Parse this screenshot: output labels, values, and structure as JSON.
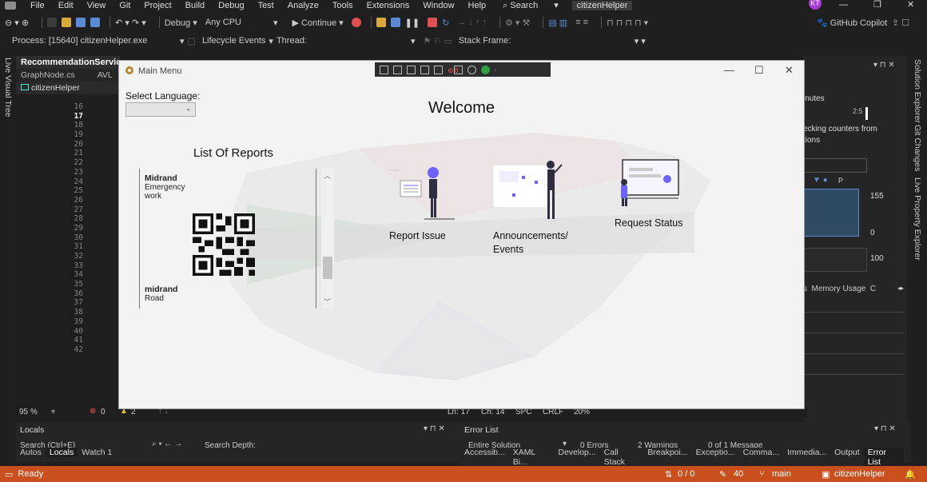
{
  "ide": {
    "menu": [
      "File",
      "Edit",
      "View",
      "Git",
      "Project",
      "Build",
      "Debug",
      "Test",
      "Analyze",
      "Tools",
      "Extensions",
      "Window",
      "Help"
    ],
    "search": "Search",
    "project_title": "citizenHelper",
    "avatar": "KT",
    "copilot": "GitHub Copilot",
    "toolbar": {
      "config": "Debug",
      "platform": "Any CPU",
      "continue": "Continue"
    },
    "toolbar2": {
      "process": "Process: [15640] citizenHelper.exe",
      "lifecycle": "Lifecycle Events",
      "thread": "Thread:",
      "stack": "Stack Frame:"
    },
    "left_tab": "Live Visual Tree",
    "editor_tabs": {
      "active": "RecommendationService",
      "second": "GraphNode.cs",
      "second_suffix": "AVL",
      "project": "citizenHelper"
    },
    "line_numbers": [
      "16",
      "17",
      "18",
      "19",
      "20",
      "21",
      "22",
      "23",
      "24",
      "25",
      "26",
      "27",
      "28",
      "29",
      "30",
      "31",
      "32",
      "33",
      "34",
      "35",
      "36",
      "37",
      "38",
      "39",
      "40",
      "41",
      "42"
    ],
    "right_panel": {
      "minutes": "inutes",
      "time": "2:5",
      "counters": "ecking counters from",
      "options": "tions",
      "legend": "P",
      "v155": "155",
      "v0": "0",
      "v100": "100",
      "tabs": "s  Memory Usage  C"
    },
    "right_tabs": [
      "Solution Explorer",
      "Git Changes",
      "Live Property Explorer"
    ],
    "status_line": {
      "zoom": "95 %",
      "errors": "0",
      "warnings": "2",
      "ln": "Ln: 17",
      "ch": "Ch: 14",
      "spc": "SPC",
      "crlf": "CRLF",
      "zoom2": "20%"
    },
    "locals": {
      "title": "Locals",
      "search": "Search (Ctrl+E)",
      "depth": "Search Depth:",
      "tabs": [
        "Autos",
        "Locals",
        "Watch 1"
      ]
    },
    "errorlist": {
      "title": "Error List",
      "scope": "Entire Solution",
      "errors": "0 Errors",
      "warnings": "2 Warnings",
      "messages": "0 of 1 Message",
      "tabs": [
        "Accessib...",
        "XAML Bi...",
        "Develop...",
        "Call Stack",
        "Breakpoi...",
        "Exceptio...",
        "Comma...",
        "Immedia...",
        "Output",
        "Error List"
      ]
    },
    "statusbar": {
      "ready": "Ready",
      "arrows": "0 / 0",
      "pencil": "40",
      "branch": "main",
      "repo": "citizenHelper"
    }
  },
  "app": {
    "title": "Main Menu",
    "debug_count": "8",
    "lang_label": "Select Language:",
    "welcome": "Welcome",
    "list_header": "List Of Reports",
    "reports": [
      {
        "name": "Midrand",
        "category": "Emergency",
        "detail": "work"
      },
      {
        "name": "midrand",
        "category": "Road",
        "detail": ""
      }
    ],
    "features": {
      "report": "Report Issue",
      "announce": "Announcements/",
      "announce2": "Events",
      "status": "Request Status"
    }
  },
  "colors": {
    "status": "#c9501c",
    "accent": "#6c63ff",
    "bg": "#1f1f1f"
  }
}
